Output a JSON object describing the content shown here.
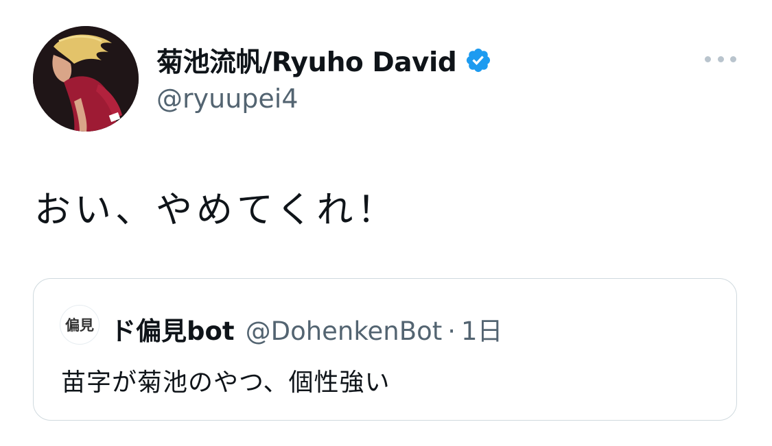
{
  "tweet": {
    "author": {
      "display_name": "菊池流帆/Ryuho David",
      "handle": "@ryuupei4",
      "verified_icon": "verified-badge-icon"
    },
    "more_icon": "more-options-icon",
    "text": "おい、やめてくれ！",
    "quote": {
      "avatar_text": "偏見",
      "display_name": "ド偏見bot",
      "handle": "@DohenkenBot",
      "separator": "·",
      "time": "1日",
      "text": "苗字が菊池のやつ、個性強い"
    }
  },
  "colors": {
    "text_primary": "#0f1419",
    "text_secondary": "#536471",
    "verified_blue": "#1d9bf0",
    "border": "#cfd9de"
  }
}
